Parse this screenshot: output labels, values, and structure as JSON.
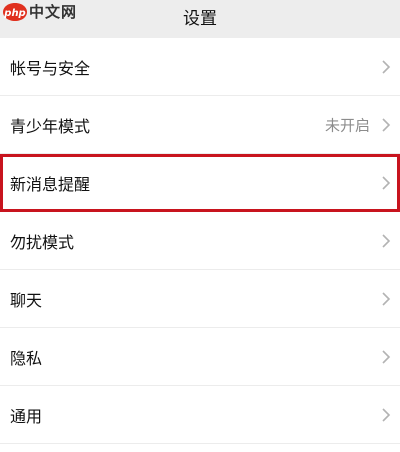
{
  "header": {
    "title": "设置"
  },
  "watermark": {
    "logo_text": "php",
    "text": "中文网"
  },
  "settings": {
    "items": [
      {
        "label": "帐号与安全",
        "value": "",
        "icon": "chevron-right-icon"
      },
      {
        "label": "青少年模式",
        "value": "未开启",
        "icon": "chevron-right-icon"
      },
      {
        "label": "新消息提醒",
        "value": "",
        "icon": "chevron-right-icon",
        "highlighted": true
      },
      {
        "label": "勿扰模式",
        "value": "",
        "icon": "chevron-right-icon"
      },
      {
        "label": "聊天",
        "value": "",
        "icon": "chevron-right-icon"
      },
      {
        "label": "隐私",
        "value": "",
        "icon": "chevron-right-icon"
      },
      {
        "label": "通用",
        "value": "",
        "icon": "chevron-right-icon"
      }
    ]
  },
  "colors": {
    "highlight_border": "#c8141e",
    "header_bg": "#ededed",
    "logo_red": "#e0301e"
  }
}
